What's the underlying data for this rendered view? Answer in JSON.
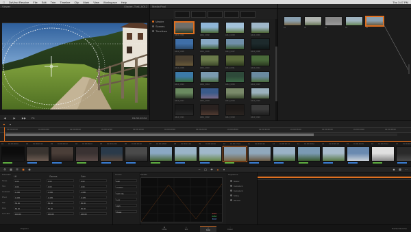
{
  "menubar": {
    "items": [
      "DaVinci Resolve",
      "File",
      "Edit",
      "Trim",
      "Timeline",
      "Clip",
      "Mark",
      "View",
      "Workspace",
      "Help"
    ],
    "status": "Thu 3:47 PM"
  },
  "viewer": {
    "title": "Viewer",
    "clip_name": "Glacier_Trail_A012",
    "timecode": "01:00:12:04",
    "zoom": "Fit"
  },
  "media": {
    "title": "Media Pool",
    "tree": [
      {
        "label": "Master",
        "active": true
      },
      {
        "label": "Scenes",
        "active": false
      },
      {
        "label": "Timelines",
        "active": false
      }
    ],
    "thumbnails": [
      {
        "label": "A012_C001",
        "colors": [
          "#6f6e6a",
          "#2d3a26"
        ],
        "selected": true
      },
      {
        "label": "A012_C002",
        "colors": [
          "#8fb6d8",
          "#4c6a3a"
        ]
      },
      {
        "label": "A012_C003",
        "colors": [
          "#a3c2da",
          "#5f7a44"
        ]
      },
      {
        "label": "A012_C004",
        "colors": [
          "#9fb7c9",
          "#4e6535"
        ]
      },
      {
        "label": "A012_C005",
        "colors": [
          "#3f6fa8",
          "#2b4a6a"
        ]
      },
      {
        "label": "A012_C006",
        "colors": [
          "#88a9c6",
          "#3c5a30"
        ]
      },
      {
        "label": "A012_C007",
        "colors": [
          "#6f8fa8",
          "#3a5a2c"
        ]
      },
      {
        "label": "A012_C008",
        "colors": [
          "#1d2a2c",
          "#101818"
        ]
      },
      {
        "label": "A012_C009",
        "colors": [
          "#4a4030",
          "#6a5a38"
        ]
      },
      {
        "label": "A012_C010",
        "colors": [
          "#6a7a4a",
          "#3e4a2a"
        ]
      },
      {
        "label": "A012_C011",
        "colors": [
          "#5a6a3a",
          "#2e3a1e"
        ]
      },
      {
        "label": "A012_C012",
        "colors": [
          "#4a6a3a",
          "#2a3a20"
        ]
      },
      {
        "label": "A012_C013",
        "colors": [
          "#3c7aa8",
          "#3a6a3a"
        ]
      },
      {
        "label": "A012_C014",
        "colors": [
          "#7a9ab0",
          "#4a6a40"
        ]
      },
      {
        "label": "A012_C015",
        "colors": [
          "#2e4a3a",
          "#3c6a46"
        ]
      },
      {
        "label": "A012_C016",
        "colors": [
          "#6a8aa0",
          "#4a6a3a"
        ]
      },
      {
        "label": "A012_C017",
        "colors": [
          "#6a8a60",
          "#2e3a2a"
        ]
      },
      {
        "label": "A012_C018",
        "colors": [
          "#3a5a8a",
          "#7a6a8a"
        ]
      },
      {
        "label": "A012_C019",
        "colors": [
          "#7a8a6a",
          "#3c4a30"
        ]
      },
      {
        "label": "A012_C020",
        "colors": [
          "#9ab0bc",
          "#4a5a3a"
        ]
      },
      {
        "label": "A012_C021",
        "colors": [
          "#1a1a1a",
          "#2a2a2a"
        ]
      },
      {
        "label": "A012_C022",
        "colors": [
          "#2a2220",
          "#503a30"
        ]
      },
      {
        "label": "A012_C023",
        "colors": [
          "#1e1a18",
          "#2a2420"
        ]
      },
      {
        "label": "A012_C024",
        "colors": [
          "#3a3a3a",
          "#1e1e1e"
        ]
      }
    ]
  },
  "strip": [
    {
      "label": "01",
      "colors": [
        "#8aa0b0",
        "#7a6a4a"
      ]
    },
    {
      "label": "02",
      "colors": [
        "#b0b4b0",
        "#6a7a5a"
      ]
    },
    {
      "label": "03",
      "colors": [
        "#8a8a8a",
        "#9a9a9a"
      ]
    },
    {
      "label": "04",
      "colors": [
        "#a0b4c0",
        "#6a8a5a"
      ]
    },
    {
      "label": "05",
      "colors": [
        "#8aa0b0",
        "#6a5a40"
      ],
      "selected": true
    }
  ],
  "timeline": {
    "ruler": [
      "01:00:00:00",
      "01:00:04:00",
      "01:00:08:00",
      "01:00:12:00",
      "01:00:16:00",
      "01:00:20:00",
      "01:00:24:00",
      "01:00:28:00",
      "01:00:32:00",
      "01:00:36:00",
      "01:00:40:00",
      "01:00:44:00",
      "01:00:48:00"
    ]
  },
  "clips": [
    {
      "num": "01",
      "tc": "01:00:00:00",
      "colors": [
        "#0c0c0c",
        "#181818"
      ]
    },
    {
      "num": "02",
      "tc": "01:00:03:12",
      "colors": [
        "#3a3430",
        "#6a5a50"
      ]
    },
    {
      "num": "03",
      "tc": "01:00:06:02",
      "colors": [
        "#4a3e38",
        "#2a2220"
      ]
    },
    {
      "num": "04",
      "tc": "01:00:09:10",
      "colors": [
        "#3a3232",
        "#5a4a46"
      ]
    },
    {
      "num": "05",
      "tc": "01:00:12:04",
      "colors": [
        "#2a3a4a",
        "#5a4a40"
      ]
    },
    {
      "num": "06",
      "tc": "01:00:15:20",
      "colors": [
        "#4a4a4a",
        "#2a2a2a"
      ]
    },
    {
      "num": "07",
      "tc": "01:00:18:08",
      "colors": [
        "#8aa8c4",
        "#4a6a3a"
      ]
    },
    {
      "num": "08",
      "tc": "01:00:21:16",
      "colors": [
        "#9ab4c8",
        "#5a7a44"
      ]
    },
    {
      "num": "09",
      "tc": "01:00:24:00",
      "colors": [
        "#a0b8ca",
        "#6a8a4a"
      ]
    },
    {
      "num": "10",
      "tc": "01:00:27:10",
      "colors": [
        "#8aa0b4",
        "#7a6a48"
      ],
      "selected": true
    },
    {
      "num": "11",
      "tc": "01:00:30:22",
      "colors": [
        "#90a8bc",
        "#6a5a44"
      ]
    },
    {
      "num": "12",
      "tc": "01:00:33:14",
      "colors": [
        "#9ab2c6",
        "#4a6a3a"
      ]
    },
    {
      "num": "13",
      "tc": "01:00:36:02",
      "colors": [
        "#7a9ab4",
        "#3a5a30"
      ]
    },
    {
      "num": "14",
      "tc": "01:00:39:18",
      "colors": [
        "#a8bccc",
        "#5a7a48"
      ]
    },
    {
      "num": "15",
      "tc": "01:00:42:06",
      "colors": [
        "#6a8ab0",
        "#c8d0d8"
      ]
    },
    {
      "num": "16",
      "tc": "01:00:45:12",
      "colors": [
        "#e0e0e0",
        "#8a8a8a"
      ]
    },
    {
      "num": "17",
      "tc": "01:00:48:00",
      "colors": [
        "#2a2a2a",
        "#4a4a4a"
      ]
    }
  ],
  "color_panel": {
    "title": "Primaries",
    "cols": [
      "Lift",
      "Gamma",
      "Gain"
    ],
    "rows": [
      {
        "label": "Temp",
        "values": [
          "0.00",
          "0.00",
          "0.00"
        ]
      },
      {
        "label": "Tint",
        "values": [
          "0.00",
          "0.00",
          "0.00"
        ]
      },
      {
        "label": "Contrast",
        "values": [
          "1.000",
          "1.000",
          "1.000"
        ]
      },
      {
        "label": "Pivot",
        "values": [
          "0.435",
          "0.435",
          "0.435"
        ]
      },
      {
        "label": "Sat",
        "values": [
          "50.00",
          "50.00",
          "50.00"
        ]
      },
      {
        "label": "Hue",
        "values": [
          "50.00",
          "50.00",
          "50.00"
        ]
      },
      {
        "label": "Lum Mix",
        "values": [
          "100.00",
          "100.00",
          "100.00"
        ]
      }
    ]
  },
  "mid_panel": {
    "title": "Curves",
    "items": [
      "Edit",
      "Custom",
      "Soft Clip",
      "Low",
      "High",
      "Reset"
    ]
  },
  "scope": {
    "title": "Parade",
    "labels": [
      "R 45",
      "G 52",
      "B 38"
    ]
  },
  "layers": {
    "title": "Keyframes",
    "rows": [
      "Master",
      "Corrector 1",
      "Corrector 2",
      "Sizing",
      "Window"
    ]
  },
  "taskbar": {
    "tabs": [
      "Media",
      "Edit",
      "Color",
      "Deliver"
    ],
    "active_tab": "Color",
    "left_text": "Project 1",
    "right_text": "DaVinci Resolve"
  },
  "colors": {
    "accent": "#e07020"
  }
}
